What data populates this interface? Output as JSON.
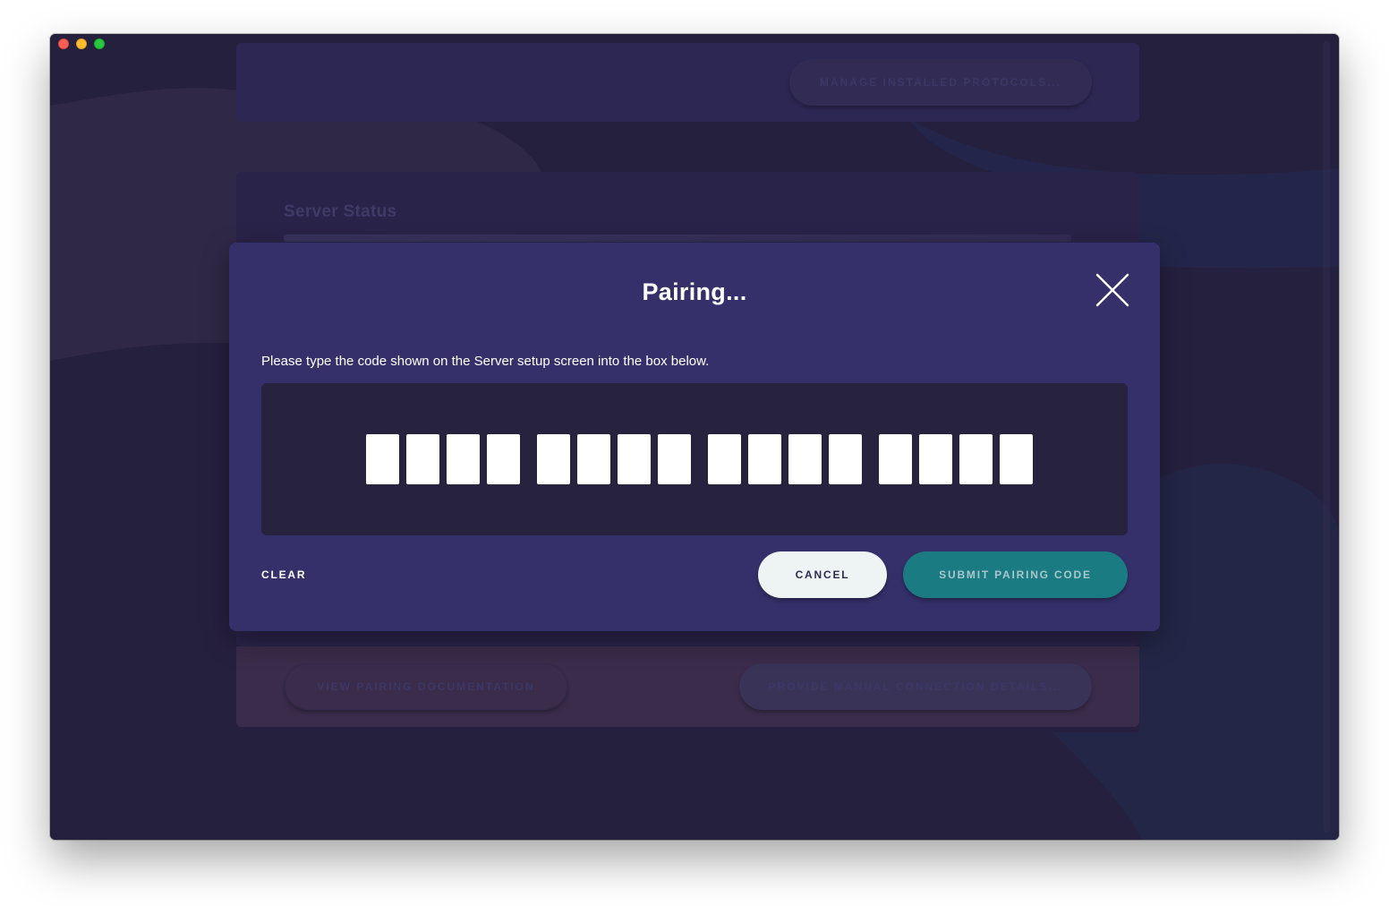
{
  "background": {
    "manage_button_label": "MANAGE INSTALLED PROTOCOLS...",
    "server_status_title": "Server Status",
    "docs_button_label": "VIEW PAIRING DOCUMENTATION",
    "manual_button_label": "PROVIDE MANUAL CONNECTION DETAILS..."
  },
  "modal": {
    "title": "Pairing...",
    "close_icon": "close-icon",
    "instruction": "Please type the code shown on the Server setup screen into the box below.",
    "code_groups": [
      [
        "",
        "",
        "",
        ""
      ],
      [
        "",
        "",
        "",
        ""
      ],
      [
        "",
        "",
        "",
        ""
      ],
      [
        "",
        "",
        "",
        ""
      ]
    ],
    "clear_label": "CLEAR",
    "cancel_label": "CANCEL",
    "submit_label": "SUBMIT PAIRING CODE"
  },
  "colors": {
    "modal_bg": "#35306a",
    "code_box_bg": "#27233f",
    "submit_bg": "#1b7b82",
    "cancel_bg": "#eef3f3"
  }
}
